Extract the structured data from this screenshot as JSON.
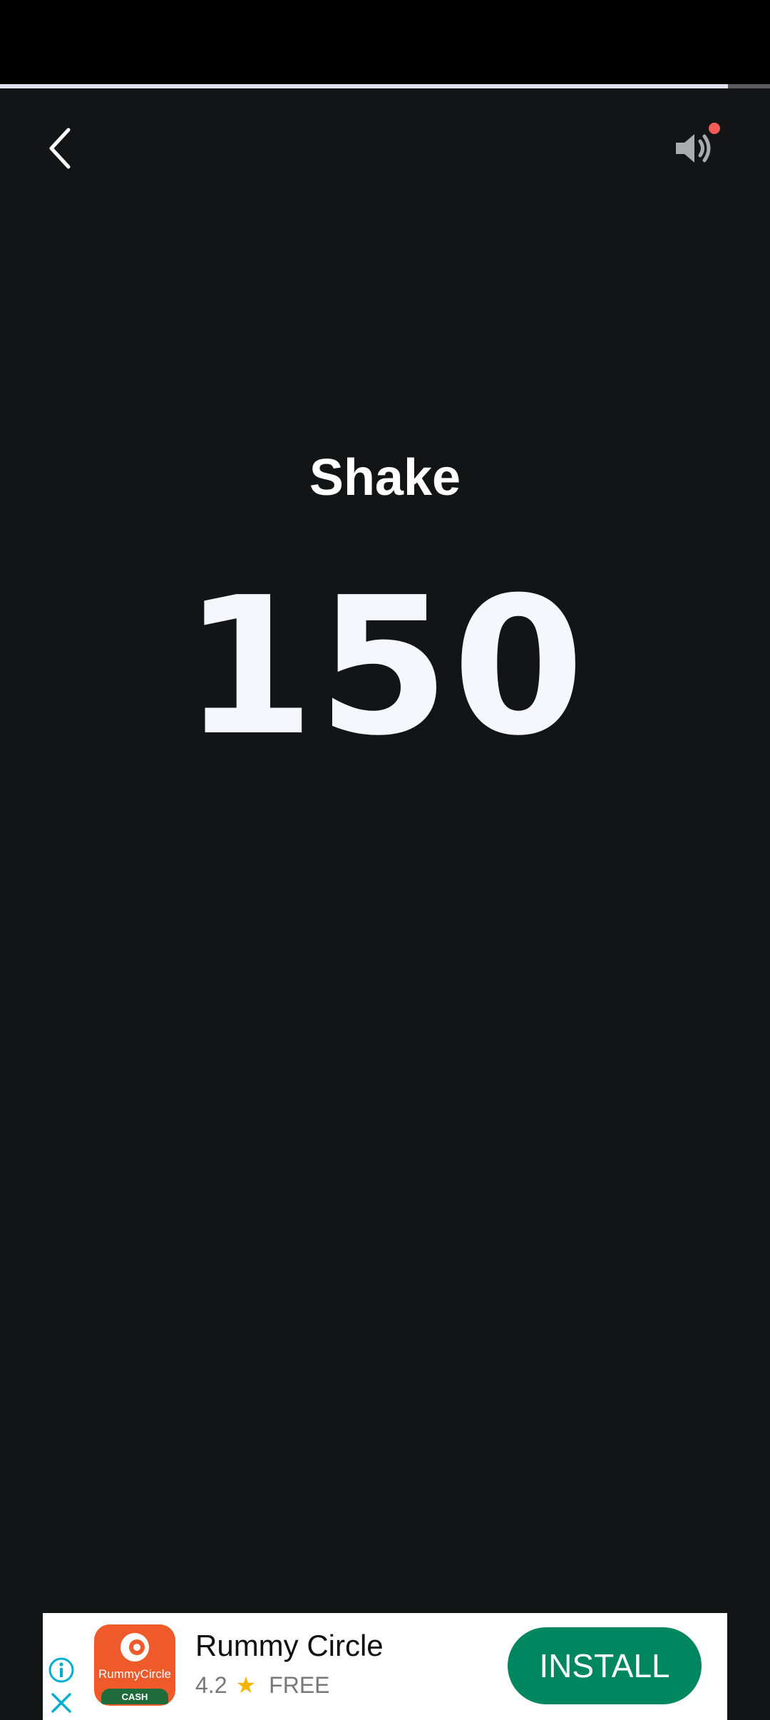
{
  "header": {
    "progress_fraction": 0.945
  },
  "main": {
    "title": "Shake",
    "counter": "150"
  },
  "ad": {
    "app_name": "Rummy Circle",
    "icon_text": "RummyCircle",
    "icon_badge": "CASH",
    "rating": "4.2",
    "price": "FREE",
    "install_label": "INSTALL"
  },
  "colors": {
    "background": "#131416",
    "accent_dot": "#f25b57",
    "install_button": "#01875f",
    "app_icon": "#ee5a2a"
  },
  "icons": {
    "back": "chevron-left-icon",
    "sound": "volume-icon",
    "info": "info-icon",
    "close": "close-icon",
    "star": "star-icon"
  }
}
